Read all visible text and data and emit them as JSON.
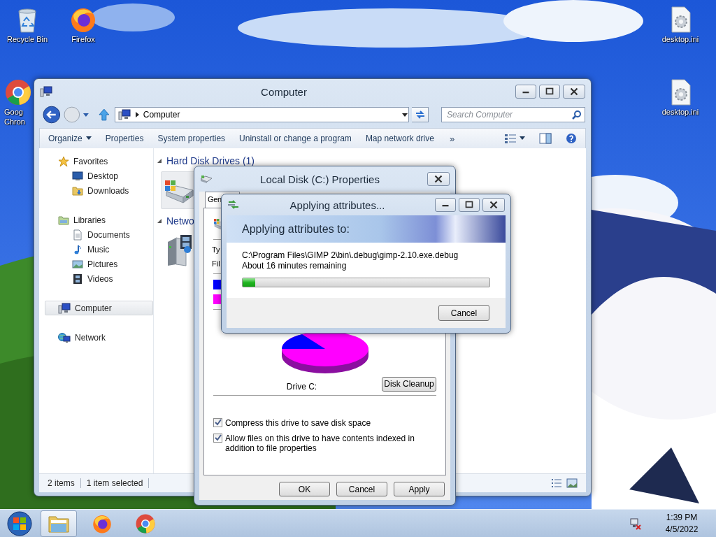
{
  "desktop_icons": [
    {
      "kind": "recycle-bin",
      "lines": [
        "Recycle Bin"
      ]
    },
    {
      "kind": "firefox",
      "lines": [
        "Firefox"
      ]
    },
    {
      "kind": "settings-file",
      "lines": [
        "desktop.ini"
      ]
    },
    {
      "kind": "chrome",
      "lines": [
        "Goog",
        "Chron"
      ]
    },
    {
      "kind": "settings-file",
      "lines": [
        "desktop.ini"
      ]
    }
  ],
  "explorer": {
    "title": "Computer",
    "breadcrumb": "Computer",
    "search": {
      "placeholder": "Search Computer"
    },
    "commands": [
      {
        "label": "Organize",
        "dropdown": true
      },
      {
        "label": "Properties",
        "dropdown": false
      },
      {
        "label": "System properties",
        "dropdown": false
      },
      {
        "label": "Uninstall or change a program",
        "dropdown": false
      },
      {
        "label": "Map network drive",
        "dropdown": false
      }
    ],
    "overflow": "»",
    "navigation": [
      {
        "label": "Favorites",
        "kind": "favorites",
        "selected": false,
        "children": [
          {
            "label": "Desktop",
            "kind": "desktop",
            "selected": false
          },
          {
            "label": "Downloads",
            "kind": "downloads",
            "selected": false
          }
        ]
      },
      {
        "label": "Libraries",
        "kind": "libraries",
        "selected": false,
        "children": [
          {
            "label": "Documents",
            "kind": "documents",
            "selected": false
          },
          {
            "label": "Music",
            "kind": "music",
            "selected": false
          },
          {
            "label": "Pictures",
            "kind": "pictures",
            "selected": false
          },
          {
            "label": "Videos",
            "kind": "videos",
            "selected": false
          }
        ]
      },
      {
        "label": "Computer",
        "kind": "computer",
        "selected": true
      },
      {
        "label": "Network",
        "kind": "network",
        "selected": false
      }
    ],
    "sections": [
      {
        "heading": "Hard Disk Drives (1)",
        "items": [
          {
            "kind": "drive",
            "selected": true
          }
        ]
      },
      {
        "heading": "Netwo",
        "items": [
          {
            "kind": "media-server",
            "selected": false
          }
        ]
      }
    ],
    "status_bar": [
      "2 items",
      "1 item selected"
    ]
  },
  "properties_dialog": {
    "title": "Local Disk (C:) Properties",
    "tabs": [
      {
        "label": "Gen",
        "selected": true
      }
    ],
    "fields": [
      "Ty",
      "Fil"
    ],
    "legend": [
      {
        "color": "#0000ff"
      },
      {
        "color": "#ff00ff"
      }
    ],
    "drive_label": "Drive C:",
    "cleanup_button": "Disk Cleanup",
    "options": [
      {
        "label": "Compress this drive to save disk space",
        "checked": true
      },
      {
        "label": "Allow files on this drive to have contents indexed in addition to file properties",
        "checked": true
      }
    ],
    "buttons": [
      "OK",
      "Cancel",
      "Apply"
    ]
  },
  "progress_dialog": {
    "title": "Applying attributes...",
    "heading": "Applying attributes to:",
    "path": "C:\\Program Files\\GIMP 2\\bin\\.debug\\gimp-2.10.exe.debug",
    "remaining": "About 16 minutes remaining",
    "level": 0.05,
    "button": "Cancel"
  },
  "taskbar": {
    "items": [
      {
        "kind": "explorer",
        "selected": true
      },
      {
        "kind": "firefox",
        "selected": false
      },
      {
        "kind": "chrome",
        "selected": false
      }
    ],
    "time": "1:39 PM",
    "date": "4/5/2022"
  }
}
